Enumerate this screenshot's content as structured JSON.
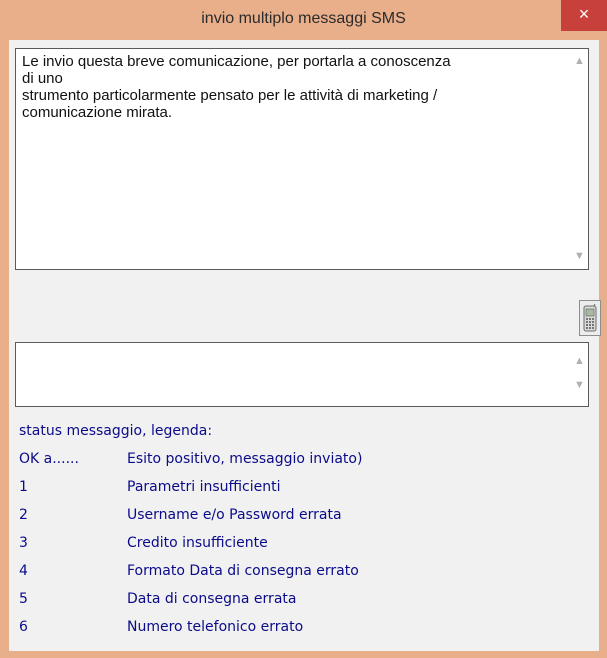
{
  "window": {
    "title": "invio multiplo messaggi SMS",
    "close_glyph": "×"
  },
  "message": {
    "text": "Le invio questa breve comunicazione, per portarla a conoscenza\ndi uno\nstrumento particolarmente pensato per le attività di marketing /\ncomunicazione mirata."
  },
  "numbers": {
    "value": ""
  },
  "legend": {
    "title": "status messaggio, legenda:",
    "rows": [
      {
        "code": "OK a......",
        "desc": "Esito positivo, messaggio inviato)"
      },
      {
        "code": "1",
        "desc": "Parametri insufficienti"
      },
      {
        "code": "2",
        "desc": "Username e/o Password errata"
      },
      {
        "code": "3",
        "desc": "Credito insufficiente"
      },
      {
        "code": "4",
        "desc": "Formato Data di consegna errato"
      },
      {
        "code": "5",
        "desc": "Data di consegna errata"
      },
      {
        "code": "6",
        "desc": "Numero telefonico errato"
      }
    ]
  },
  "icons": {
    "send": "mobile-phone-icon",
    "scroll_up": "chevron-up-icon",
    "scroll_down": "chevron-down-icon",
    "close": "close-icon"
  },
  "colors": {
    "frame": "#e9af8b",
    "close": "#c7403b",
    "legend_text": "#0b0b8a"
  }
}
